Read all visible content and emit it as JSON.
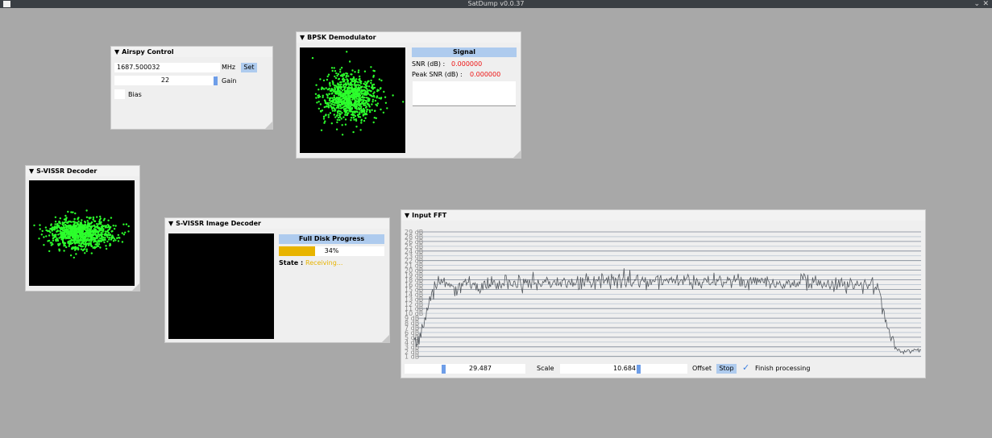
{
  "app": {
    "title": "SatDump v0.0.37",
    "close_glyph": "✕",
    "minimize_glyph": "⌄"
  },
  "collapse_glyph": "▼",
  "airspy": {
    "title": "Airspy Control",
    "frequency": "1687.500032",
    "freq_unit": "MHz",
    "set_label": "Set",
    "gain_value": "22",
    "gain_label": "Gain",
    "bias_label": "Bias"
  },
  "bpsk": {
    "title": "BPSK Demodulator",
    "signal_header": "Signal",
    "snr_label": "SNR (dB) :",
    "snr_value": "0.000000",
    "peak_snr_label": "Peak SNR (dB) :",
    "peak_snr_value": "0.000000",
    "value_color": "#ee1111"
  },
  "svissr": {
    "title": "S-VISSR Decoder"
  },
  "image_decoder": {
    "title": "S-VISSR Image Decoder",
    "progress_header": "Full Disk Progress",
    "progress_fraction": 0.34,
    "progress_text": "34%",
    "state_label": "State :",
    "state_value": "Receiving...",
    "progress_color": "#e8b400"
  },
  "fft": {
    "title": "Input FFT",
    "db_labels": [
      "29 dB",
      "28 dB",
      "26 dB",
      "25 dB",
      "24 dB",
      "23 dB",
      "22 dB",
      "21 dB",
      "20 dB",
      "19 dB",
      "18 dB",
      "16 dB",
      "15 dB",
      "14 dB",
      "13 dB",
      "12 dB",
      "11 dB",
      "10 dB",
      "9 dB",
      "8 dB",
      "7 dB",
      "6 dB",
      "5 dB",
      "4 dB",
      "3 dB",
      "2 dB",
      "1 dB"
    ],
    "scale_value": "29.487",
    "scale_label": "Scale",
    "offset_value": "10.684",
    "offset_label": "Offset",
    "stop_label": "Stop",
    "finish_label": "Finish processing",
    "check_glyph": "✓"
  },
  "colors": {
    "constellation": "#2cff2c",
    "accent": "#aecbee"
  }
}
